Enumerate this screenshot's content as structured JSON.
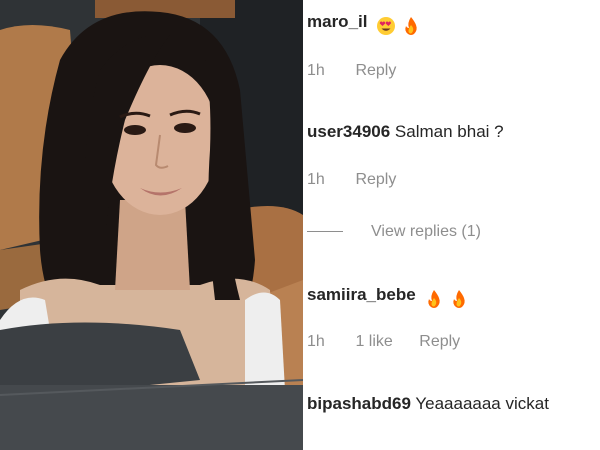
{
  "comments": [
    {
      "username": "maro_il",
      "text": "",
      "emojis": [
        "heart-eyes-emoji",
        "fire-emoji"
      ],
      "time": "1h",
      "likes": "",
      "reply_label": "Reply"
    },
    {
      "username": "user34906",
      "text": "Salman bhai ?",
      "emojis": [],
      "time": "1h",
      "likes": "",
      "reply_label": "Reply",
      "view_replies": "View replies (1)"
    },
    {
      "username": "samiira_bebe",
      "text": "",
      "emojis": [
        "fire-emoji",
        "fire-emoji"
      ],
      "time": "1h",
      "likes": "1 like",
      "reply_label": "Reply"
    },
    {
      "username": "bipashabd69",
      "text": "Yeaaaaaaa vickat",
      "emojis": []
    }
  ],
  "colors": {
    "username": "#262626",
    "meta": "#8e8e8e",
    "background": "#ffffff",
    "fire": "#ff6a00",
    "emoji_face": "#ffcc33"
  }
}
